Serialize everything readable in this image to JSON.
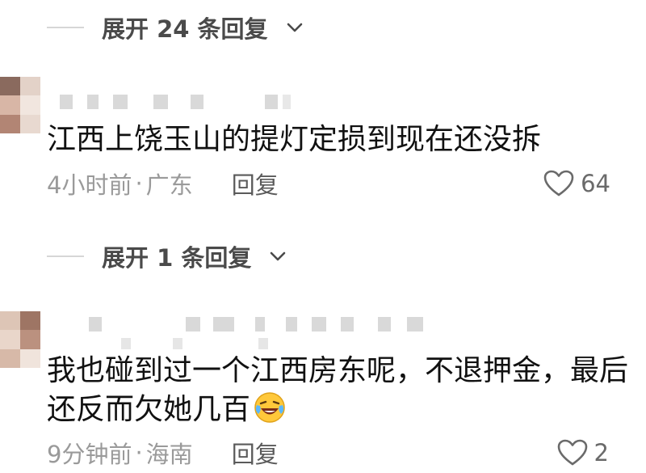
{
  "thread1": {
    "expand_label": "展开 24 条回复"
  },
  "comment1": {
    "text": "江西上饶玉山的提灯定损到现在还没拆",
    "time": "4小时前",
    "dot": "·",
    "location": "广东",
    "reply_label": "回复",
    "likes": "64"
  },
  "thread2": {
    "expand_label": "展开 1 条回复"
  },
  "comment2": {
    "text_line1": "我也碰到过一个江西房东呢，不退押金，最后",
    "text_line2": "还反而欠她几百",
    "time": "9分钟前",
    "dot": "·",
    "location": "海南",
    "reply_label": "回复",
    "likes": "2"
  },
  "icons": {
    "chevron": "chevron-down-icon",
    "like": "heart-outline-icon",
    "emoji": "laughing-crying-emoji-icon"
  },
  "colors": {
    "text": "#111111",
    "meta": "#9a9a9a",
    "accent_gray": "#4a4a4a"
  }
}
